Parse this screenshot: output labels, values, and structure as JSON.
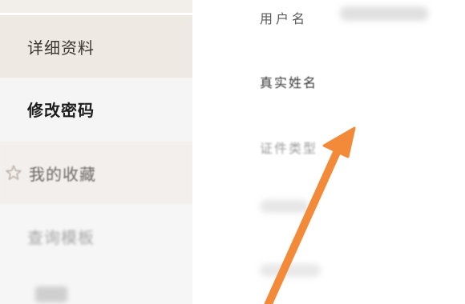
{
  "sidebar": {
    "items": [
      {
        "label": "详细资料",
        "state": "selected"
      },
      {
        "label": "修改密码",
        "state": "active"
      },
      {
        "label": "我的收藏",
        "icon": "star-outline-icon"
      },
      {
        "label": "查询模板"
      }
    ]
  },
  "form": {
    "fields": [
      {
        "label": "用户名"
      },
      {
        "label": "真实姓名"
      },
      {
        "label": "证件类型"
      }
    ]
  },
  "colors": {
    "sidebar_bg": "#f5f5f5",
    "selected_bg": "#efe9e3",
    "arrow": "#f28a3a",
    "star": "#b5aaa3"
  }
}
